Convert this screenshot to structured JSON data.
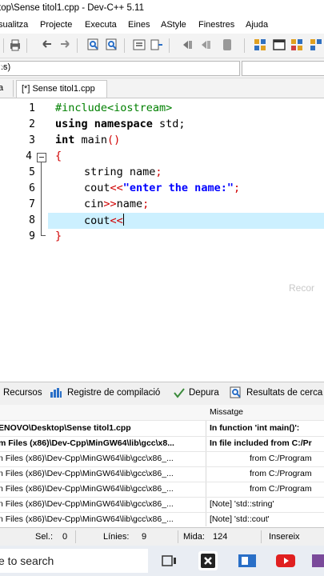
{
  "window": {
    "title": "top\\Sense titol1.cpp - Dev-C++ 5.11"
  },
  "menu": [
    "sualitza",
    "Projecte",
    "Executa",
    "Eines",
    "AStyle",
    "Finestres",
    "Ajuda"
  ],
  "combo": {
    "value": ".s)"
  },
  "tabs": {
    "left_stub": "a",
    "active": "[*] Sense titol1.cpp"
  },
  "editor": {
    "line_numbers": [
      "1",
      "2",
      "3",
      "4",
      "5",
      "6",
      "7",
      "8",
      "9"
    ],
    "fold_marker": "⊟",
    "watermark": "Recor",
    "lines": {
      "l1": "#include<iostream>",
      "l2_kw": "using namespace",
      "l2_rest": " std;",
      "l3_kw": "int",
      "l3_rest": " main",
      "l3_paren": "()",
      "l4": "{",
      "l5_ident": "string name",
      "l5_semi": ";",
      "l6_ident": "cout",
      "l6_op": "<<",
      "l6_str": "\"enter the name:\"",
      "l6_semi": ";",
      "l7_ident": "cin",
      "l7_op": ">>",
      "l7_name": "name",
      "l7_semi": ";",
      "l8_ident": "cout",
      "l8_op": "<<",
      "l9": "}"
    },
    "colors": {
      "keyword": "#000000",
      "preprocessor": "#008000",
      "operator": "#d00000",
      "string": "#0000ff",
      "current_line": "#ccf0ff"
    }
  },
  "bottom_tabs": {
    "recursos": "Recursos",
    "registre": "Registre de compilació",
    "depura": "Depura",
    "resultats": "Resultats de cerca"
  },
  "messages": {
    "header": "Missatge",
    "rows": [
      {
        "file": "ENOVO\\Desktop\\Sense titol1.cpp",
        "message": "In function 'int main()':",
        "bold": true
      },
      {
        "file": "m Files (x86)\\Dev-Cpp\\MinGW64\\lib\\gcc\\x8...",
        "message": "In file included from C:/Pr",
        "bold": true
      },
      {
        "file": "n Files (x86)\\Dev-Cpp\\MinGW64\\lib\\gcc\\x86_...",
        "message": "from C:/Program",
        "bold": false
      },
      {
        "file": "n Files (x86)\\Dev-Cpp\\MinGW64\\lib\\gcc\\x86_...",
        "message": "from C:/Program",
        "bold": false
      },
      {
        "file": "n Files (x86)\\Dev-Cpp\\MinGW64\\lib\\gcc\\x86_...",
        "message": "from C:/Program",
        "bold": false
      },
      {
        "file": "n Files (x86)\\Dev-Cpp\\MinGW64\\lib\\gcc\\x86_...",
        "message": "[Note] 'std::string'",
        "bold": false
      },
      {
        "file": "n Files (x86)\\Dev-Cpp\\MinGW64\\lib\\gcc\\x86_...",
        "message": "[Note] 'std::cout'",
        "bold": false
      }
    ]
  },
  "status": {
    "sel_label": "Sel.:",
    "sel_value": "0",
    "lines_label": "Línies:",
    "lines_value": "9",
    "size_label": "Mida:",
    "size_value": "124",
    "mode": "Insereix"
  },
  "taskbar": {
    "search_placeholder": "e to search"
  }
}
